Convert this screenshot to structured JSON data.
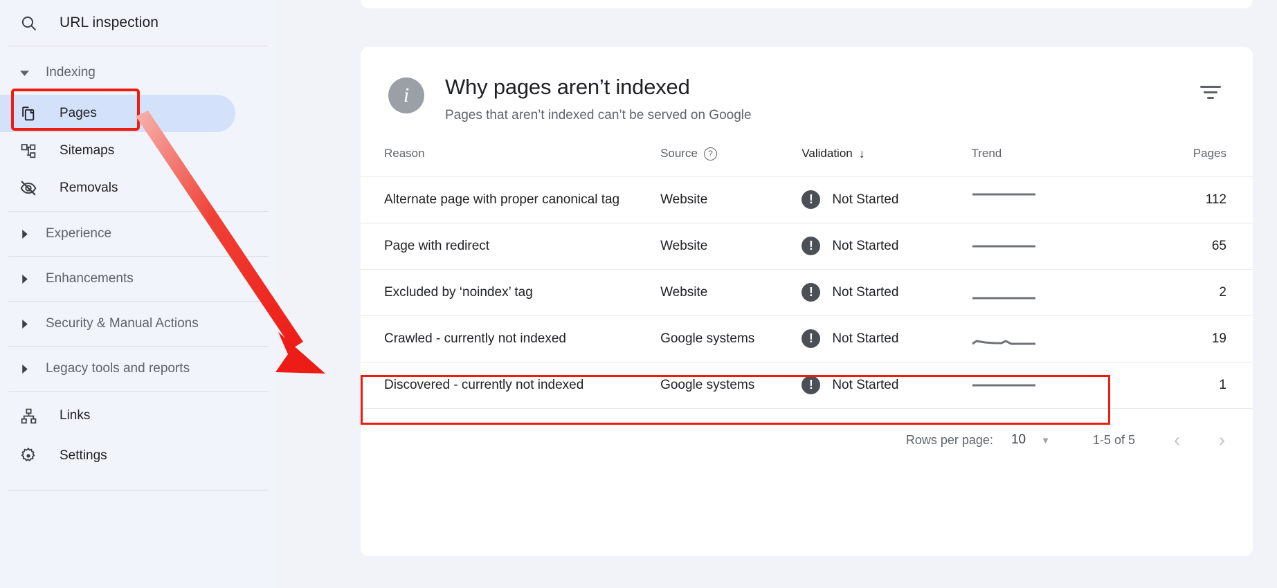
{
  "sidebar": {
    "search": {
      "label": "URL inspection",
      "icon": "search-icon"
    },
    "groups": [
      {
        "label": "Indexing",
        "expanded": true,
        "items": [
          {
            "label": "Pages",
            "icon": "pages-icon",
            "selected": true
          },
          {
            "label": "Sitemaps",
            "icon": "sitemaps-icon",
            "selected": false
          },
          {
            "label": "Removals",
            "icon": "removals-icon",
            "selected": false
          }
        ]
      },
      {
        "label": "Experience",
        "expanded": false,
        "items": []
      },
      {
        "label": "Enhancements",
        "expanded": false,
        "items": []
      },
      {
        "label": "Security & Manual Actions",
        "expanded": false,
        "items": []
      },
      {
        "label": "Legacy tools and reports",
        "expanded": false,
        "items": []
      }
    ],
    "footer_items": [
      {
        "label": "Links",
        "icon": "links-icon"
      },
      {
        "label": "Settings",
        "icon": "gear-icon"
      }
    ]
  },
  "card": {
    "icon": "info-icon",
    "title": "Why pages aren’t indexed",
    "subtitle": "Pages that aren’t indexed can’t be served on Google",
    "filter_icon": "filter-icon"
  },
  "table": {
    "columns": [
      {
        "key": "reason",
        "label": "Reason"
      },
      {
        "key": "source",
        "label": "Source",
        "help_icon": "help-icon"
      },
      {
        "key": "validation",
        "label": "Validation",
        "sort_icon": "sort-descending-arrow"
      },
      {
        "key": "trend",
        "label": "Trend"
      },
      {
        "key": "pages",
        "label": "Pages"
      }
    ],
    "rows": [
      {
        "reason": "Alternate page with proper canonical tag",
        "source": "Website",
        "validation": "Not Started",
        "status_icon": "exclamation-icon",
        "trend": "flat",
        "pages": "112"
      },
      {
        "reason": "Page with redirect",
        "source": "Website",
        "validation": "Not Started",
        "status_icon": "exclamation-icon",
        "trend": "flat",
        "pages": "65"
      },
      {
        "reason": "Excluded by ‘noindex’ tag",
        "source": "Website",
        "validation": "Not Started",
        "status_icon": "exclamation-icon",
        "trend": "flat",
        "pages": "2"
      },
      {
        "reason": "Crawled - currently not indexed",
        "source": "Google systems",
        "validation": "Not Started",
        "status_icon": "exclamation-icon",
        "trend": "wavy",
        "pages": "19"
      },
      {
        "reason": "Discovered - currently not indexed",
        "source": "Google systems",
        "validation": "Not Started",
        "status_icon": "exclamation-icon",
        "trend": "flat",
        "pages": "1",
        "highlighted": true
      }
    ]
  },
  "pagination": {
    "rows_per_page_label": "Rows per page:",
    "rows_per_page_value": "10",
    "caret_icon": "chevron-down-icon",
    "range": "1-5 of 5",
    "prev_icon": "chevron-left-icon",
    "next_icon": "chevron-right-icon"
  },
  "annotations": {
    "highlight_color": "#f01b0d",
    "arrow_color": "#ee2a20"
  }
}
